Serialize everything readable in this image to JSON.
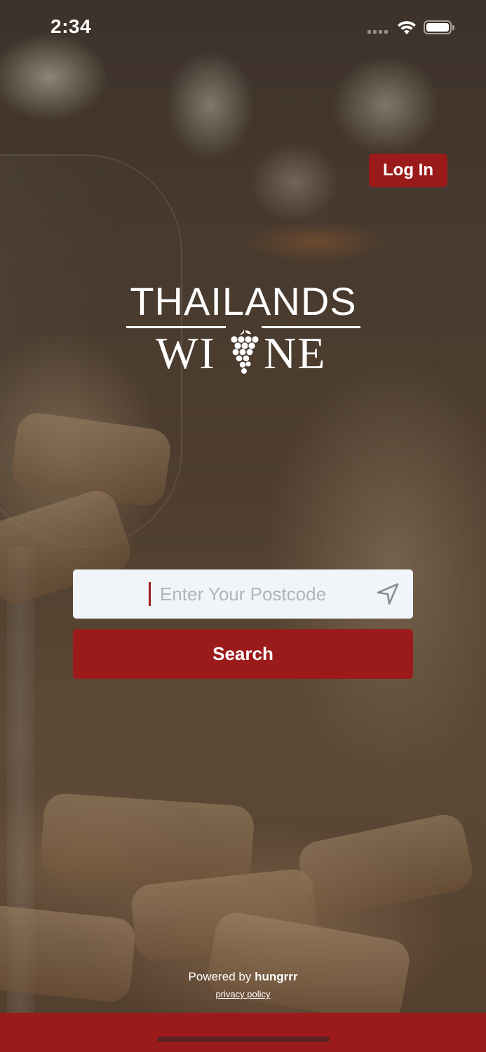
{
  "status_bar": {
    "time": "2:34"
  },
  "header": {
    "login_label": "Log In"
  },
  "logo": {
    "line1": "THAILANDS",
    "line2_left": "WI",
    "line2_right": "NE",
    "icon": "grape-icon"
  },
  "search": {
    "placeholder": "Enter Your Postcode",
    "value": "",
    "location_icon": "location-arrow-icon",
    "button_label": "Search"
  },
  "footer": {
    "powered_by_prefix": "Powered by",
    "powered_by_brand": "hungrrr",
    "privacy_label": "privacy policy"
  },
  "colors": {
    "brand_red": "#9b1b1b",
    "input_background": "#f1f4f8",
    "placeholder_text": "#b2b5ba"
  }
}
